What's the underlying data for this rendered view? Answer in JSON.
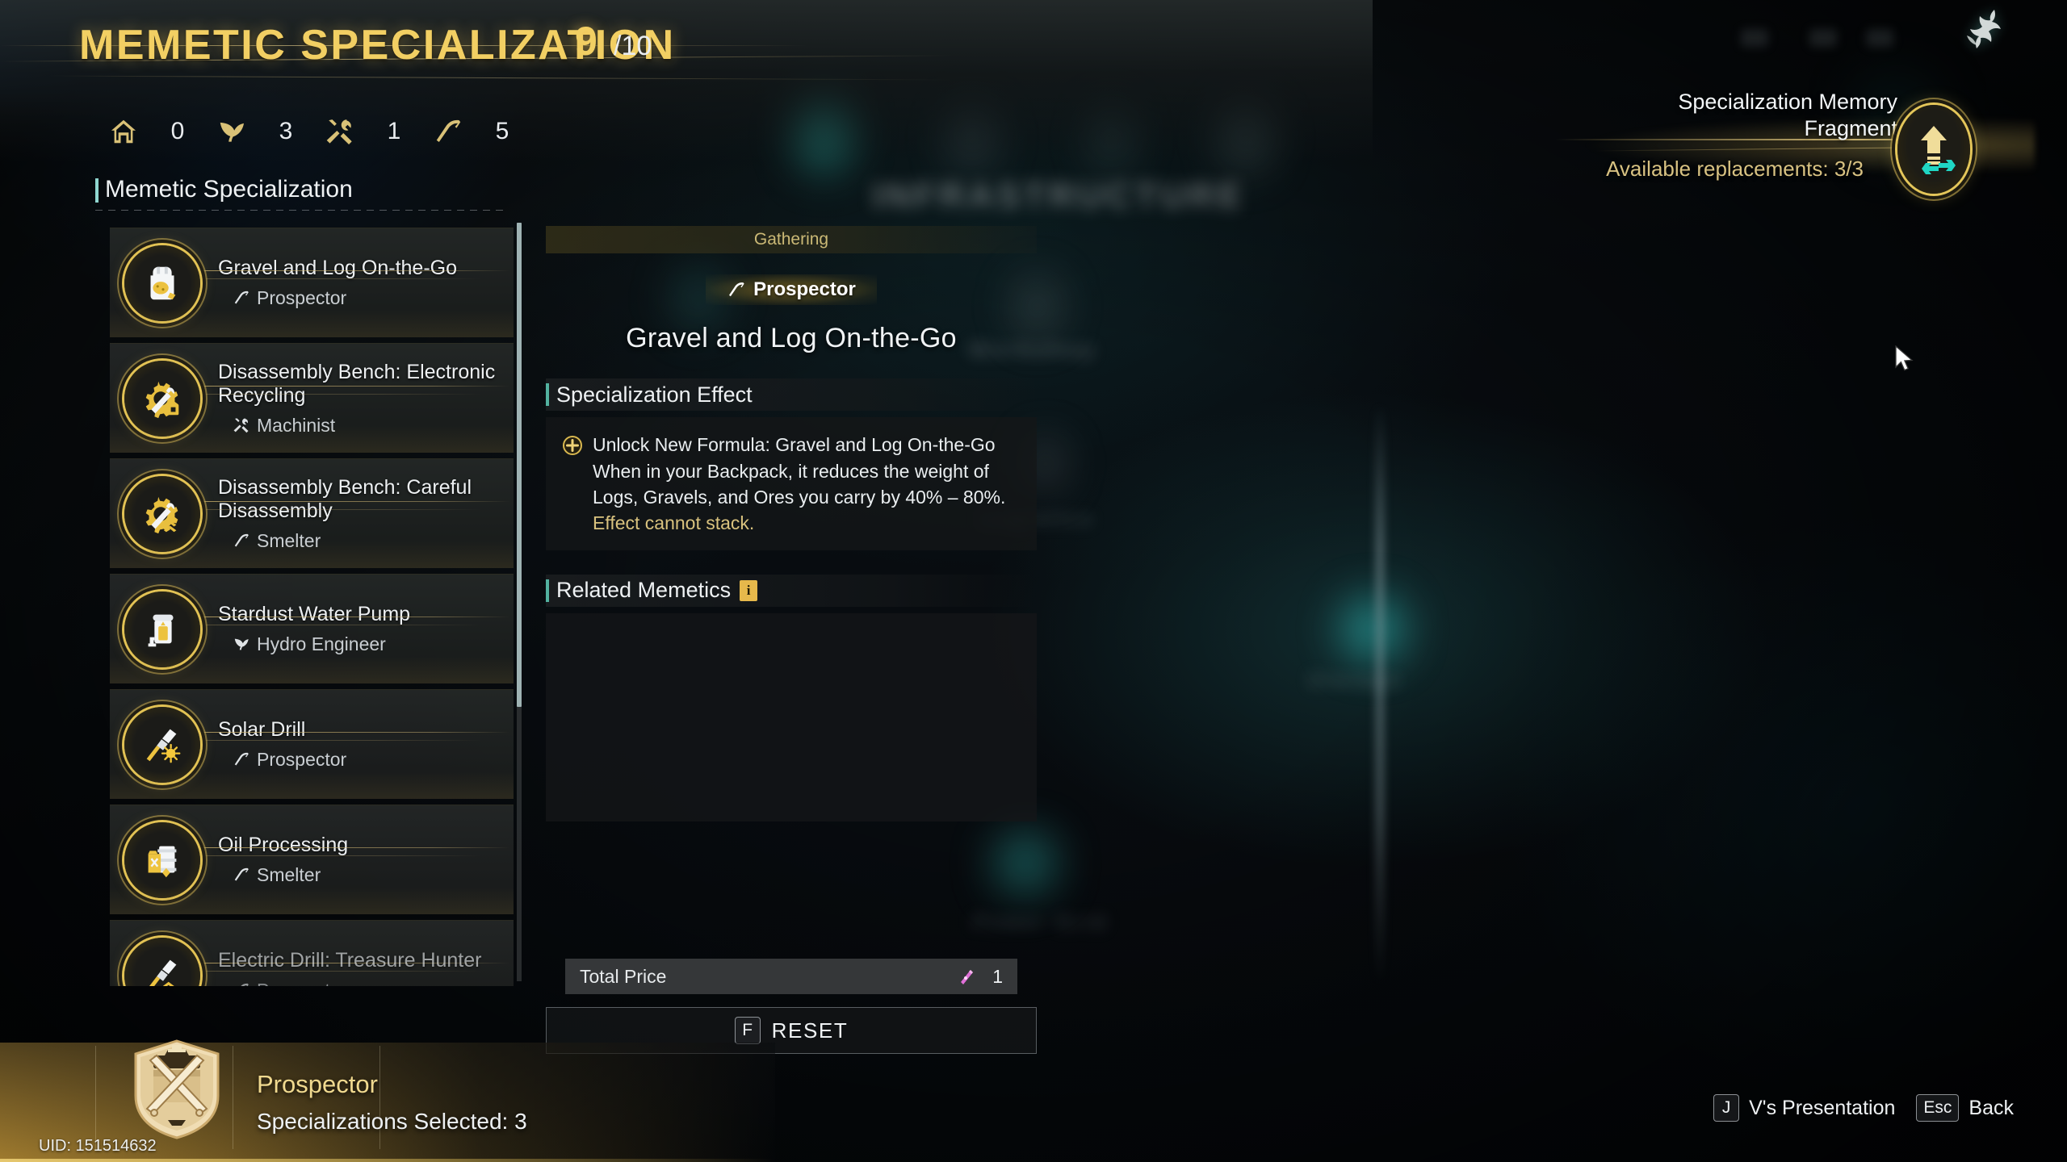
{
  "header": {
    "title": "MEMETIC SPECIALIZATION",
    "count": "9",
    "max": "/10",
    "stats": [
      {
        "icon": "home-icon",
        "value": "0"
      },
      {
        "icon": "leaf-icon",
        "value": "3"
      },
      {
        "icon": "tools-icon",
        "value": "1"
      },
      {
        "icon": "pickaxe-icon",
        "value": "5"
      }
    ]
  },
  "fragment_panel": {
    "title_line1": "Specialization Memory",
    "title_line2": "Fragment",
    "replacements": "Available replacements: 3/3",
    "icon": "upgrade-swap-icon"
  },
  "sidebar": {
    "heading": "Memetic Specialization",
    "items": [
      {
        "name": "Gravel and Log On-the-Go",
        "role": "Prospector",
        "role_icon": "pickaxe-icon",
        "badge_icon": "backpack-gravel-icon"
      },
      {
        "name": "Disassembly Bench: Electronic Recycling",
        "role": "Machinist",
        "role_icon": "tools-icon",
        "badge_icon": "gear-wrench-chip-icon"
      },
      {
        "name": "Disassembly Bench: Careful Disassembly",
        "role": "Smelter",
        "role_icon": "pickaxe-icon",
        "badge_icon": "gear-wrench-chevron-icon"
      },
      {
        "name": "Stardust Water Pump",
        "role": "Hydro Engineer",
        "role_icon": "leaf-icon",
        "badge_icon": "water-pump-icon"
      },
      {
        "name": "Solar Drill",
        "role": "Prospector",
        "role_icon": "pickaxe-icon",
        "badge_icon": "drill-sun-icon"
      },
      {
        "name": "Oil Processing",
        "role": "Smelter",
        "role_icon": "pickaxe-icon",
        "badge_icon": "oil-barrel-icon"
      },
      {
        "name": "Electric Drill: Treasure Hunter",
        "role": "Prospector",
        "role_icon": "pickaxe-icon",
        "badge_icon": "drill-chevron-icon"
      }
    ]
  },
  "detail": {
    "category_tab": "Gathering",
    "role": "Prospector",
    "role_icon": "pickaxe-icon",
    "title": "Gravel and Log On-the-Go",
    "effect_section_label": "Specialization Effect",
    "effect_text": "Unlock New Formula: Gravel and Log On-the-Go\nWhen in your Backpack, it reduces the weight of Logs, Gravels, and Ores you carry by 40% – 80%.",
    "effect_warning": "Effect cannot stack.",
    "related_section_label": "Related Memetics",
    "related_info_icon": "info-icon",
    "price_label": "Total Price",
    "price_value": "1",
    "price_icon": "memory-fragment-icon",
    "reset_key": "F",
    "reset_label": "RESET"
  },
  "footer": {
    "role": "Prospector",
    "selected": "Specializations Selected: 3",
    "uid": "UID: 151514632",
    "crest_icon": "prospector-crest-icon"
  },
  "hints": [
    {
      "key": "J",
      "label": "V's Presentation"
    },
    {
      "key": "Esc",
      "label": "Back"
    }
  ],
  "background_text": {
    "t1": "INFRASTRUCTURE",
    "t2": "Workshop",
    "t3": "Logistics",
    "t4": "Power Grid",
    "t5": "Storage"
  },
  "colors": {
    "gold": "#f2cf63",
    "teal": "#53b2a0",
    "text": "#eef1f3",
    "warn": "#d9c27e"
  }
}
